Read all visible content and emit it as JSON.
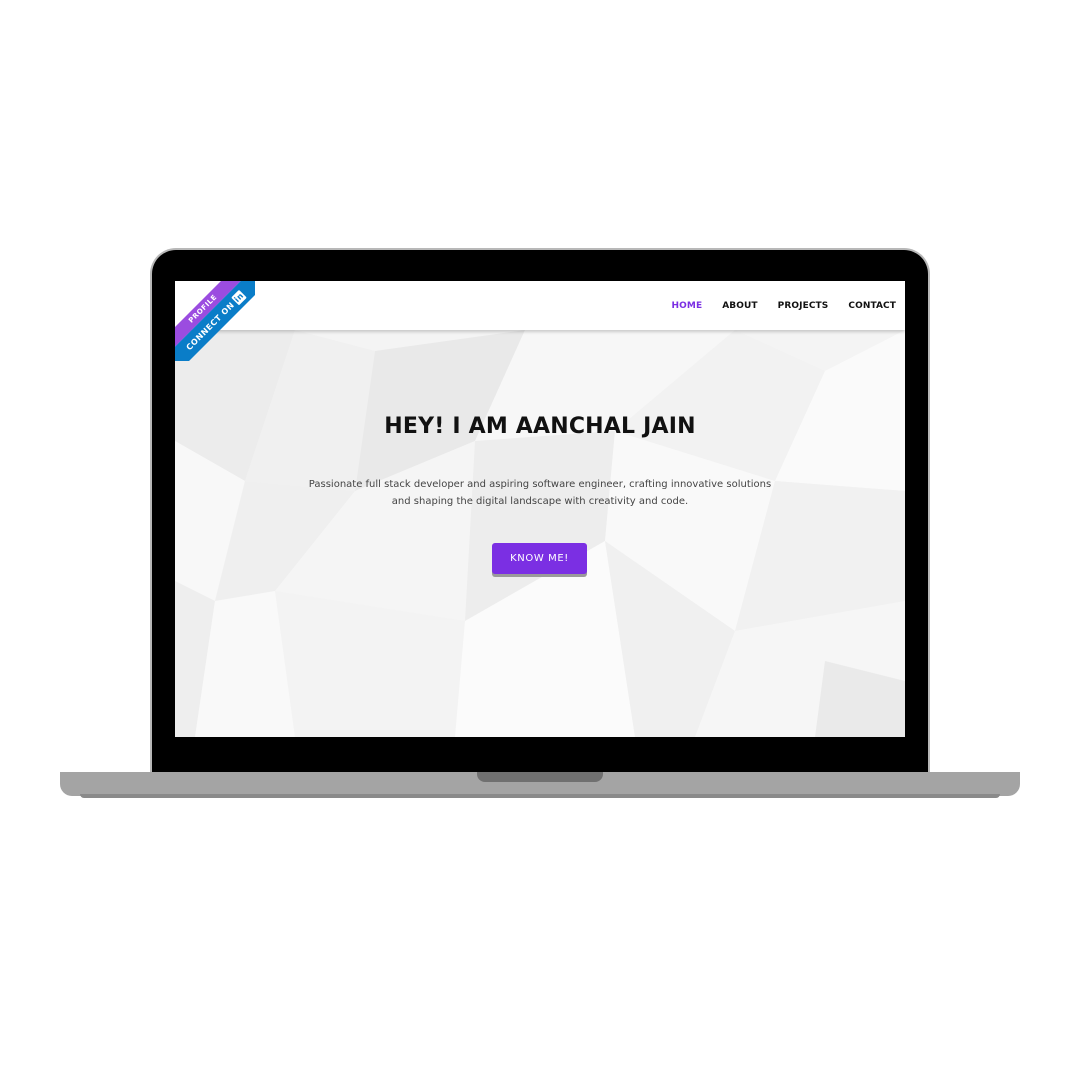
{
  "nav": {
    "items": [
      {
        "label": "HOME",
        "active": true
      },
      {
        "label": "ABOUT",
        "active": false
      },
      {
        "label": "PROJECTS",
        "active": false
      },
      {
        "label": "CONTACT",
        "active": false
      }
    ]
  },
  "ribbon": {
    "top_text": "PROFILE",
    "bottom_text": "CONNECT ON",
    "icon_text": "in"
  },
  "hero": {
    "title": "HEY! I AM AANCHAL JAIN",
    "description": "Passionate full stack developer and aspiring software engineer, crafting innovative solutions and shaping the digital landscape with creativity and code.",
    "button_label": "KNOW ME!"
  },
  "colors": {
    "accent": "#7b2fe3",
    "ribbon_purple": "#9b4ce0",
    "ribbon_blue": "#0a7dc8"
  }
}
